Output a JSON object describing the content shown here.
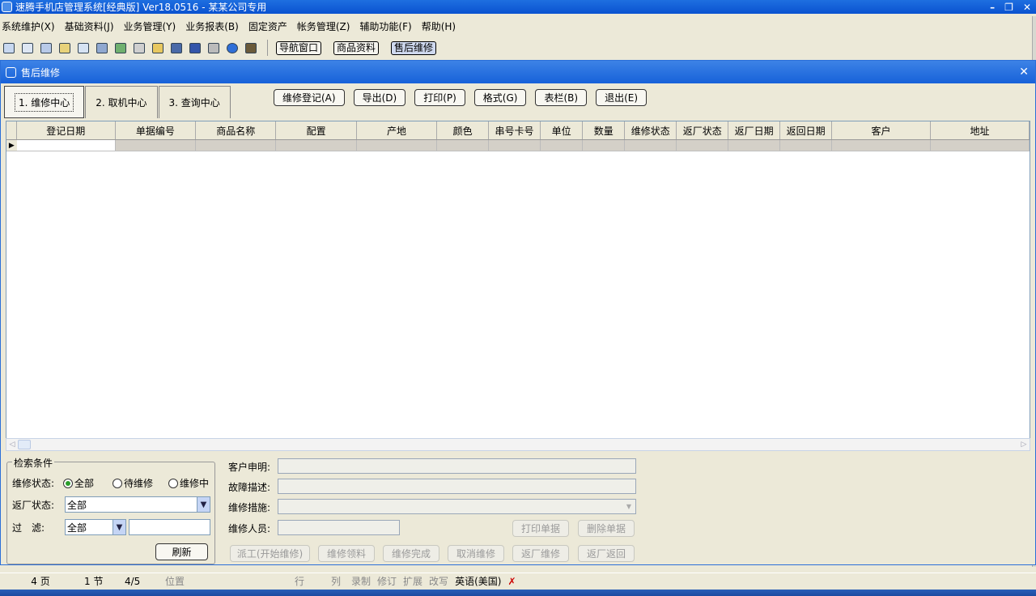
{
  "window": {
    "title": "速腾手机店管理系统[经典版] Ver18.0516 - 某某公司专用"
  },
  "menu": [
    "系统维护(X)",
    "基础资料(J)",
    "业务管理(Y)",
    "业务报表(B)",
    "固定资产",
    "帐务管理(Z)",
    "辅助功能(F)",
    "帮助(H)"
  ],
  "toolbar": {
    "buttons": [
      "导航窗口",
      "商品资料",
      "售后维修"
    ]
  },
  "child_window": {
    "title": "售后维修"
  },
  "tabs": [
    "1. 维修中心",
    "2. 取机中心",
    "3. 查询中心"
  ],
  "actions": [
    "维修登记(A)",
    "导出(D)",
    "打印(P)",
    "格式(G)",
    "表栏(B)",
    "退出(E)"
  ],
  "grid": {
    "columns": [
      "登记日期",
      "单据编号",
      "商品名称",
      "配置",
      "产地",
      "颜色",
      "串号卡号",
      "单位",
      "数量",
      "维修状态",
      "返厂状态",
      "返厂日期",
      "返回日期",
      "客户",
      "地址"
    ]
  },
  "search": {
    "legend": "检索条件",
    "status_label": "维修状态:",
    "radios": [
      "全部",
      "待维修",
      "维修中"
    ],
    "return_label": "返厂状态:",
    "return_value": "全部",
    "filter_label": "过　滤:",
    "filter_value": "全部",
    "refresh": "刷新"
  },
  "detail": {
    "labels": [
      "客户申明:",
      "故障描述:",
      "维修措施:",
      "维修人员:"
    ],
    "print_btn": "打印单据",
    "delete_btn": "删除单据",
    "bottom_buttons": [
      "派工(开始维修)",
      "维修领料",
      "维修完成",
      "取消维修",
      "返厂维修",
      "返厂返回"
    ]
  },
  "statusbar": {
    "page": "4 页",
    "section": "1 节",
    "pages": "4/5",
    "position": "位置",
    "row": "行",
    "col": "列",
    "rec": "录制",
    "rev": "修订",
    "ext": "扩展",
    "ovr": "改写",
    "lang": "英语(美国)"
  }
}
